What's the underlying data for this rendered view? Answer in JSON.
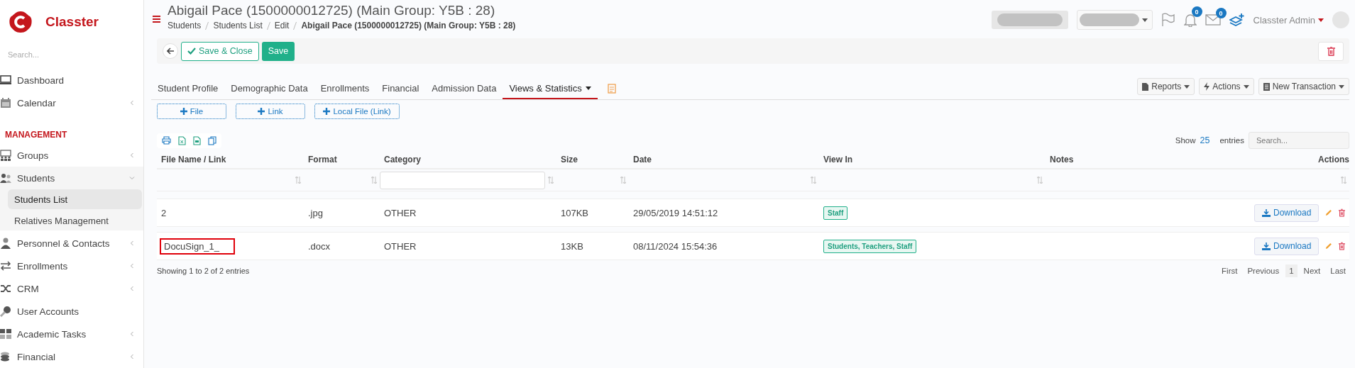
{
  "sidebar": {
    "brand": "Classter",
    "search_placeholder": "Search...",
    "items": [
      {
        "kind": "item",
        "label": "Dashboard"
      },
      {
        "kind": "item",
        "label": "Calendar",
        "expanded": false
      },
      {
        "kind": "section",
        "label": "MANAGEMENT"
      },
      {
        "kind": "item",
        "label": "Groups",
        "expanded": false
      },
      {
        "kind": "item",
        "label": "Students",
        "expanded": true,
        "children": [
          {
            "label": "Students List",
            "selected": true
          },
          {
            "label": "Relatives Management",
            "selected": false
          }
        ]
      },
      {
        "kind": "item",
        "label": "Personnel & Contacts",
        "expanded": false
      },
      {
        "kind": "item",
        "label": "Enrollments",
        "expanded": false
      },
      {
        "kind": "item",
        "label": "CRM",
        "expanded": false
      },
      {
        "kind": "item",
        "label": "User Accounts"
      },
      {
        "kind": "item",
        "label": "Academic Tasks",
        "expanded": false
      },
      {
        "kind": "item",
        "label": "Financial",
        "expanded": false
      }
    ]
  },
  "header": {
    "title": "Abigail Pace (1500000012725) (Main Group: Y5B : 28)",
    "breadcrumb": [
      "Students",
      "Students List",
      "Edit",
      "Abigail Pace (1500000012725) (Main Group: Y5B : 28)"
    ],
    "notifications_count": "0",
    "messages_count": "0",
    "user": "Classter Admin"
  },
  "toolbar": {
    "save_close": "Save & Close",
    "save": "Save"
  },
  "tabs": [
    {
      "label": "Student Profile",
      "selected": false,
      "dropdown": false
    },
    {
      "label": "Demographic Data",
      "selected": false,
      "dropdown": false
    },
    {
      "label": "Enrollments",
      "selected": false,
      "dropdown": false
    },
    {
      "label": "Financial",
      "selected": false,
      "dropdown": false
    },
    {
      "label": "Admission Data",
      "selected": false,
      "dropdown": false
    },
    {
      "label": "Views & Statistics",
      "selected": true,
      "dropdown": true
    }
  ],
  "tab_actions": [
    "Reports",
    "Actions",
    "New Transaction"
  ],
  "add_buttons": [
    "File",
    "Link",
    "Local File (Link)"
  ],
  "table": {
    "show_label": "Show",
    "page_size": "25",
    "entries_label": "entries",
    "search_placeholder": "Search...",
    "columns": [
      "File Name / Link",
      "Format",
      "Category",
      "Size",
      "Date",
      "View In",
      "Notes",
      "Actions"
    ],
    "rows": [
      {
        "name": "2",
        "format": ".jpg",
        "category": "OTHER",
        "size": "107KB",
        "date": "29/05/2019 14:51:12",
        "view_in": "Staff",
        "action": "Download",
        "highlighted": false
      },
      {
        "name": "DocuSign_1_",
        "format": ".docx",
        "category": "OTHER",
        "size": "13KB",
        "date": "08/11/2024 15:54:36",
        "view_in": "Students, Teachers, Staff",
        "action": "Download",
        "highlighted": true
      }
    ],
    "summary": "Showing 1 to 2 of 2 entries",
    "pagination": [
      {
        "label": "First",
        "selected": false
      },
      {
        "label": "Previous",
        "selected": false
      },
      {
        "label": "1",
        "selected": true
      },
      {
        "label": "Next",
        "selected": false
      },
      {
        "label": "Last",
        "selected": false
      }
    ]
  }
}
